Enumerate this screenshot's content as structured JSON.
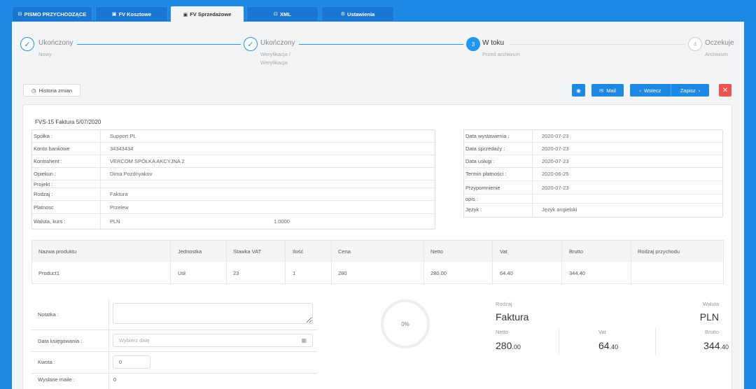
{
  "tabs": [
    {
      "label": "PISMO PRZYCHODZĄCE",
      "icon": "inbox-icon"
    },
    {
      "label": "FV Kosztowe",
      "icon": "file-icon"
    },
    {
      "label": "FV Sprzedażowe",
      "icon": "file-icon"
    },
    {
      "label": "XML",
      "icon": "code-icon"
    },
    {
      "label": "Ustawienia",
      "icon": "gear-icon"
    }
  ],
  "steps": [
    {
      "number": "✓",
      "title": "Ukończony",
      "sub": "Nowy",
      "status": "done"
    },
    {
      "number": "✓",
      "title": "Ukończony",
      "sub": "Weryfikacja /",
      "sub2": "Weryfikacja",
      "status": "done"
    },
    {
      "number": "3",
      "title": "W toku",
      "sub": "Przed archiwum",
      "status": "active"
    },
    {
      "number": "4",
      "title": "Oczekuje",
      "sub": "Archiwum",
      "status": "pending"
    }
  ],
  "toolbar": {
    "history": "Historia zmian",
    "mail": "Mail",
    "back": "Wstecz",
    "save": "Zapisz",
    "close": "✕"
  },
  "doc": {
    "title": "FVS-15 Faktura 5/07/2020",
    "left": [
      {
        "label": "Spółka :",
        "value": "Support PL"
      },
      {
        "label": "Konto bankowe",
        "value": "34343434"
      },
      {
        "label": "Kontrahent :",
        "value": "VERCOM SPÓŁKA AKCYJNA 2"
      },
      {
        "label": "Opiekun :",
        "value": "Dima Pozdnyakov"
      },
      {
        "label": "Projekt :",
        "value": ""
      },
      {
        "label": "Rodzaj :",
        "value": "Faktura"
      },
      {
        "label": "Platnosc",
        "value": "Przelew"
      },
      {
        "label": "Waluta, kurs :",
        "value": "PLN",
        "value2": "1.0000"
      }
    ],
    "right": [
      {
        "label": "Data wystawienia :",
        "value": "2020-07-23"
      },
      {
        "label": "Data sprzedaży :",
        "value": "2020-07-23"
      },
      {
        "label": "Data usługi :",
        "value": "2020-07-23"
      },
      {
        "label": "Termin płatności :",
        "value": "2020-06-25"
      },
      {
        "label": "Przypomnienie",
        "value": "2020-07-23"
      },
      {
        "label": "opis :",
        "value": ""
      },
      {
        "label": "Język :",
        "value": "Język angielski"
      }
    ]
  },
  "products": {
    "headers": [
      "Nazwa produktu",
      "Jednostka",
      "Stawka VAT",
      "Ilość",
      "Cena",
      "Netto",
      "Vat",
      "Brutto",
      "Rodzaj przychodu"
    ],
    "rows": [
      [
        "Product1",
        "Usł",
        "23",
        "1",
        "280",
        "280.00",
        "64.40",
        "344.40",
        ""
      ]
    ]
  },
  "form": {
    "note_label": "Notatka :",
    "date_label": "Data księgowania :",
    "date_placeholder": "Wybierz datę",
    "amount_label": "Kwota :",
    "amount_value": "0",
    "mails_label": "Wysłane maile :",
    "mails_value": "0"
  },
  "summary": {
    "gauge": "0%",
    "gauge_fraction": 0,
    "rodzaj_label": "Rodzaj",
    "rodzaj_value": "Faktura",
    "waluta_label": "Waluta",
    "waluta_value": "PLN",
    "netto_label": "Netto",
    "netto_int": "280",
    "netto_dec": ".00",
    "vat_label": "Vat",
    "vat_int": "64",
    "vat_dec": ".40",
    "brutto_label": "Brutto",
    "brutto_int": "344",
    "brutto_dec": ".40"
  },
  "colors": {
    "accent": "#1e88e5",
    "danger": "#ef5350"
  }
}
